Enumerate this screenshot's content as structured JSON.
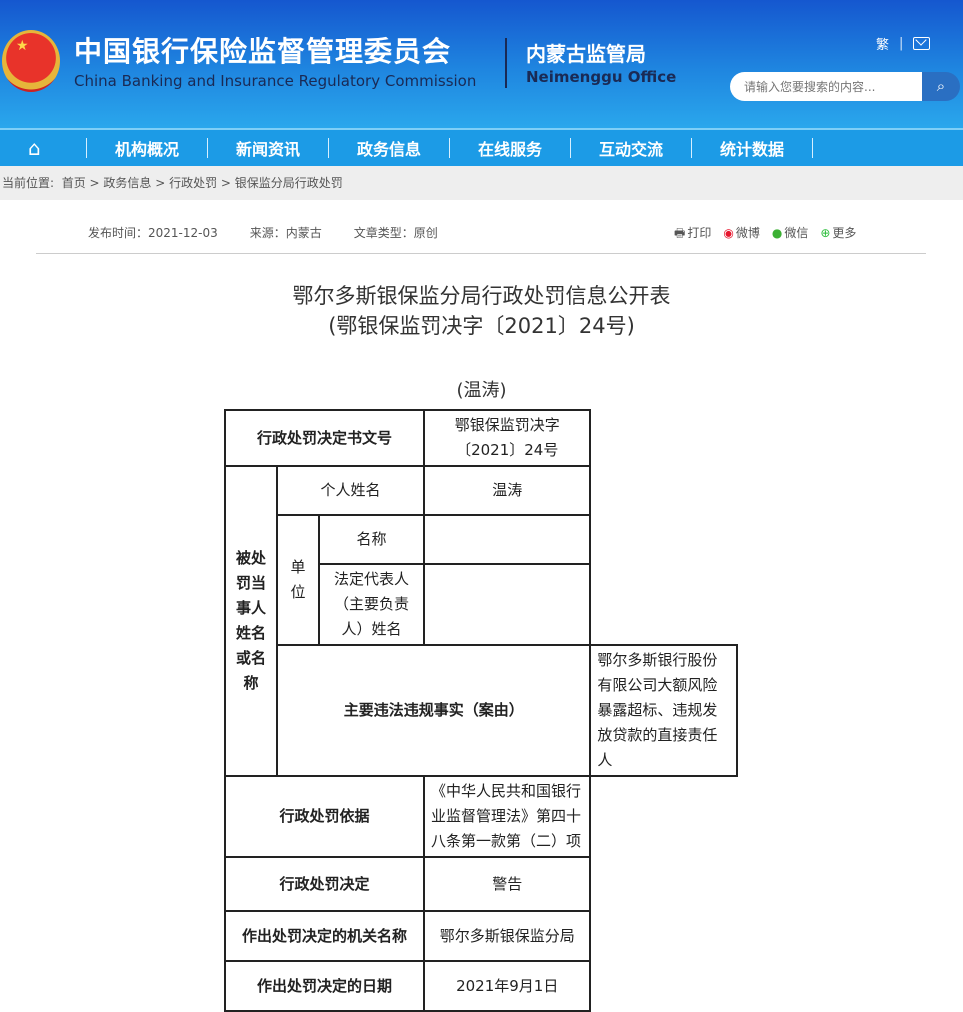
{
  "header": {
    "title_cn": "中国银行保险监督管理委员会",
    "title_en": "China Banking and Insurance Regulatory Commission",
    "office_cn": "内蒙古监管局",
    "office_en": "Neimenggu Office",
    "traditional": "繁",
    "search_placeholder": "请输入您要搜索的内容..."
  },
  "nav": [
    "机构概况",
    "新闻资讯",
    "政务信息",
    "在线服务",
    "互动交流",
    "统计数据"
  ],
  "breadcrumb": {
    "label": "当前位置:",
    "items": [
      "首页",
      "政务信息",
      "行政处罚",
      "银保监分局行政处罚"
    ]
  },
  "meta": {
    "date": "发布时间：2021-12-03",
    "source": "来源：内蒙古",
    "type": "文章类型：原创"
  },
  "share": {
    "print": "打印",
    "weibo": "微博",
    "wechat": "微信",
    "more": "更多"
  },
  "article": {
    "title": "鄂尔多斯银保监分局行政处罚信息公开表",
    "subtitle": "(鄂银保监罚决字〔2021〕24号)",
    "name": "(温涛)"
  },
  "table": {
    "r1": [
      "行政处罚决定书文号",
      "鄂银保监罚决字〔2021〕24号"
    ],
    "party": "被处罚当事人姓名或名称",
    "person_label": "个人姓名",
    "person_value": "温涛",
    "unit": "单位",
    "unit_name": "名称",
    "unit_rep": "法定代表人（主要负责人）姓名",
    "r5": [
      "主要违法违规事实（案由）",
      "鄂尔多斯银行股份有限公司大额风险暴露超标、违规发放贷款的直接责任人"
    ],
    "r6": [
      "行政处罚依据",
      "《中华人民共和国银行业监督管理法》第四十八条第一款第（二）项"
    ],
    "r7": [
      "行政处罚决定",
      "警告"
    ],
    "r8": [
      "作出处罚决定的机关名称",
      "鄂尔多斯银保监分局"
    ],
    "r9": [
      "作出处罚决定的日期",
      "2021年9月1日"
    ]
  }
}
